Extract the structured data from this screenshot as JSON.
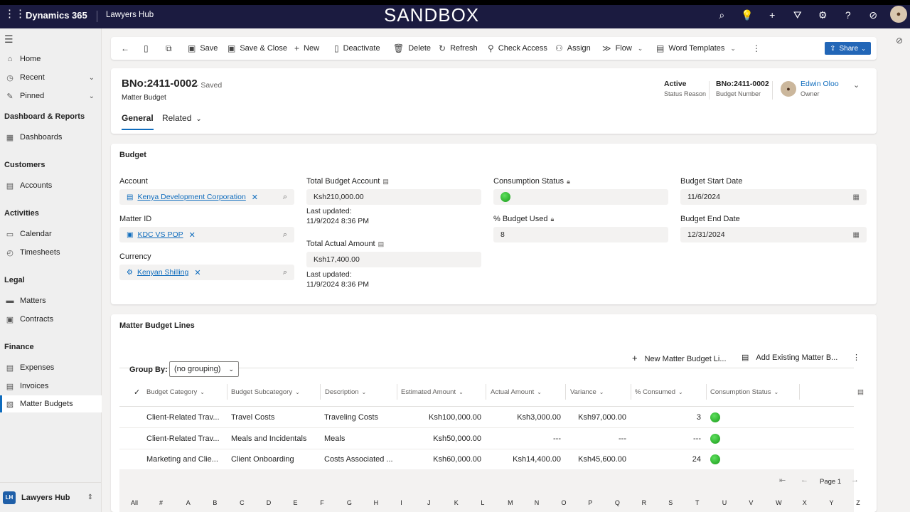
{
  "topbar": {
    "brand": "Dynamics 365",
    "app": "Lawyers Hub",
    "env": "SANDBOX",
    "icons": [
      "search-icon",
      "lightbulb-icon",
      "plus-icon",
      "filter-icon",
      "gear-icon",
      "help-icon",
      "copilot-icon",
      "user-avatar"
    ]
  },
  "sidebar": {
    "items": [
      {
        "label": "Home"
      },
      {
        "label": "Recent"
      },
      {
        "label": "Pinned"
      }
    ],
    "groups": {
      "dashboards": "Dashboard & Reports",
      "customers": "Customers",
      "activities": "Activities",
      "legal": "Legal",
      "finance": "Finance"
    },
    "links": {
      "dashboards": "Dashboards",
      "accounts": "Accounts",
      "calendar": "Calendar",
      "timesheets": "Timesheets",
      "matters": "Matters",
      "contracts": "Contracts",
      "expenses": "Expenses",
      "invoices": "Invoices",
      "matter_budgets": "Matter Budgets"
    },
    "footer": {
      "badge": "LH",
      "name": "Lawyers Hub"
    }
  },
  "commands": {
    "save": "Save",
    "save_close": "Save & Close",
    "new": "New",
    "deactivate": "Deactivate",
    "delete": "Delete",
    "refresh": "Refresh",
    "check_access": "Check Access",
    "assign": "Assign",
    "flow": "Flow",
    "word_templates": "Word Templates",
    "share": "Share"
  },
  "record": {
    "title": "BNo:2411-0002",
    "saved": "- Saved",
    "entity": "Matter Budget",
    "tabs": {
      "general": "General",
      "related": "Related"
    },
    "status_reason": {
      "value": "Active",
      "label": "Status Reason"
    },
    "budget_number": {
      "value": "BNo:2411-0002",
      "label": "Budget Number"
    },
    "owner": {
      "name": "Edwin Oloo",
      "label": "Owner"
    }
  },
  "budget": {
    "section_title": "Budget",
    "account_label": "Account",
    "account_value": "Kenya Development Corporation",
    "matter_label": "Matter ID",
    "matter_value": "KDC VS POP",
    "currency_label": "Currency",
    "currency_value": "Kenyan Shilling",
    "total_budget_label": "Total Budget Account",
    "total_budget_value": "Ksh210,000.00",
    "last_updated_label": "Last updated:",
    "last_updated_1": "11/9/2024 8:36 PM",
    "total_actual_label": "Total Actual Amount",
    "total_actual_value": "Ksh17,400.00",
    "last_updated_2": "11/9/2024 8:36 PM",
    "consumption_label": "Consumption Status",
    "pct_label": "% Budget Used",
    "pct_value": "8",
    "start_label": "Budget Start Date",
    "start_value": "11/6/2024",
    "end_label": "Budget End Date",
    "end_value": "12/31/2024"
  },
  "lines": {
    "section_title": "Matter Budget Lines",
    "new_btn": "New Matter Budget Li...",
    "add_existing_btn": "Add Existing Matter B...",
    "group_by_label": "Group By:",
    "group_by_value": "(no grouping)",
    "columns": [
      "Budget Category",
      "Budget Subcategory",
      "Description",
      "Estimated Amount",
      "Actual Amount",
      "Variance",
      "% Consumed",
      "Consumption Status"
    ],
    "rows": [
      {
        "category": "Client-Related Trav...",
        "subcategory": "Travel Costs",
        "description": "Traveling Costs",
        "estimated": "Ksh100,000.00",
        "actual": "Ksh3,000.00",
        "variance": "Ksh97,000.00",
        "consumed": "3"
      },
      {
        "category": "Client-Related Trav...",
        "subcategory": "Meals and Incidentals",
        "description": "Meals",
        "estimated": "Ksh50,000.00",
        "actual": "---",
        "variance": "---",
        "consumed": "---"
      },
      {
        "category": "Marketing and Clie...",
        "subcategory": "Client Onboarding",
        "description": "Costs Associated ...",
        "estimated": "Ksh60,000.00",
        "actual": "Ksh14,400.00",
        "variance": "Ksh45,600.00",
        "consumed": "24"
      }
    ],
    "page": "Page 1",
    "alphabet": [
      "All",
      "#",
      "A",
      "B",
      "C",
      "D",
      "E",
      "F",
      "G",
      "H",
      "I",
      "J",
      "K",
      "L",
      "M",
      "N",
      "O",
      "P",
      "Q",
      "R",
      "S",
      "T",
      "U",
      "V",
      "W",
      "X",
      "Y",
      "Z"
    ]
  },
  "colors": {
    "topbar": "#1b1b40",
    "accent": "#0f6cbd",
    "status_green": "#1a9a1a"
  }
}
